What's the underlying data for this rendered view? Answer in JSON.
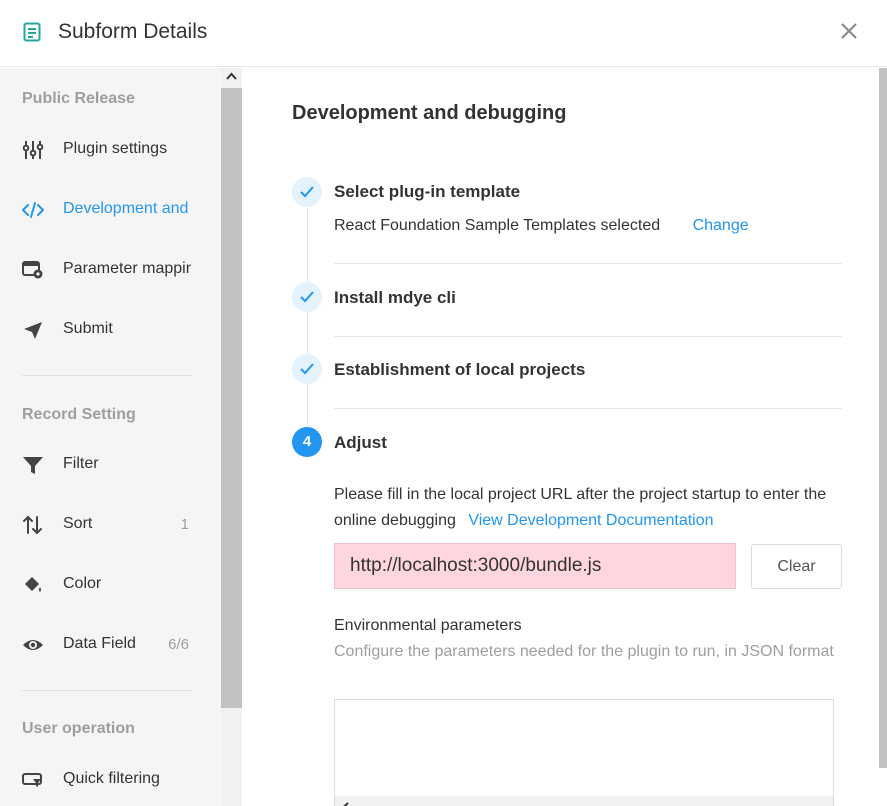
{
  "header": {
    "title": "Subform Details",
    "icon": "document-icon",
    "close_icon": "close-icon"
  },
  "sidebar": {
    "sections": [
      {
        "title": "Public Release"
      },
      {
        "title": "Record Setting"
      },
      {
        "title": "User operation"
      }
    ],
    "items": [
      {
        "label": "Plugin settings",
        "icon": "sliders-icon",
        "active": false
      },
      {
        "label": "Development and debugging",
        "icon": "code-icon",
        "active": true
      },
      {
        "label": "Parameter mapping",
        "icon": "parameter-mapping-icon",
        "active": false
      },
      {
        "label": "Submit",
        "icon": "send-icon",
        "active": false
      },
      {
        "label": "Filter",
        "icon": "filter-icon",
        "active": false
      },
      {
        "label": "Sort",
        "icon": "sort-icon",
        "count": "1",
        "active": false
      },
      {
        "label": "Color",
        "icon": "paint-bucket-icon",
        "active": false
      },
      {
        "label": "Data Field",
        "icon": "eye-icon",
        "count": "6/6",
        "active": false
      },
      {
        "label": "Quick filtering",
        "icon": "quick-filter-icon",
        "active": false
      }
    ]
  },
  "main": {
    "title": "Development and debugging",
    "steps": [
      {
        "title": "Select plug-in template",
        "status": "done",
        "description": "React Foundation Sample Templates selected",
        "action_label": "Change"
      },
      {
        "title": "Install mdye cli",
        "status": "done"
      },
      {
        "title": "Establishment of local projects",
        "status": "done"
      },
      {
        "number": "4",
        "title": "Adjust",
        "status": "current",
        "description": "Please fill in the local project URL after the project startup to enter the online debugging",
        "link_label": "View Development Documentation",
        "url_value": "http://localhost:3000/bundle.js",
        "clear_label": "Clear",
        "env_title": "Environmental parameters",
        "env_description": "Configure the parameters needed for the plugin to run, in JSON format",
        "env_value": ""
      }
    ]
  },
  "colors": {
    "accent": "#2196f3",
    "step_done_bg": "#e3f2fd",
    "input_highlight": "#ffd6e0",
    "sidebar_bg": "#f5f5f5",
    "muted_text": "#9e9e9e"
  }
}
